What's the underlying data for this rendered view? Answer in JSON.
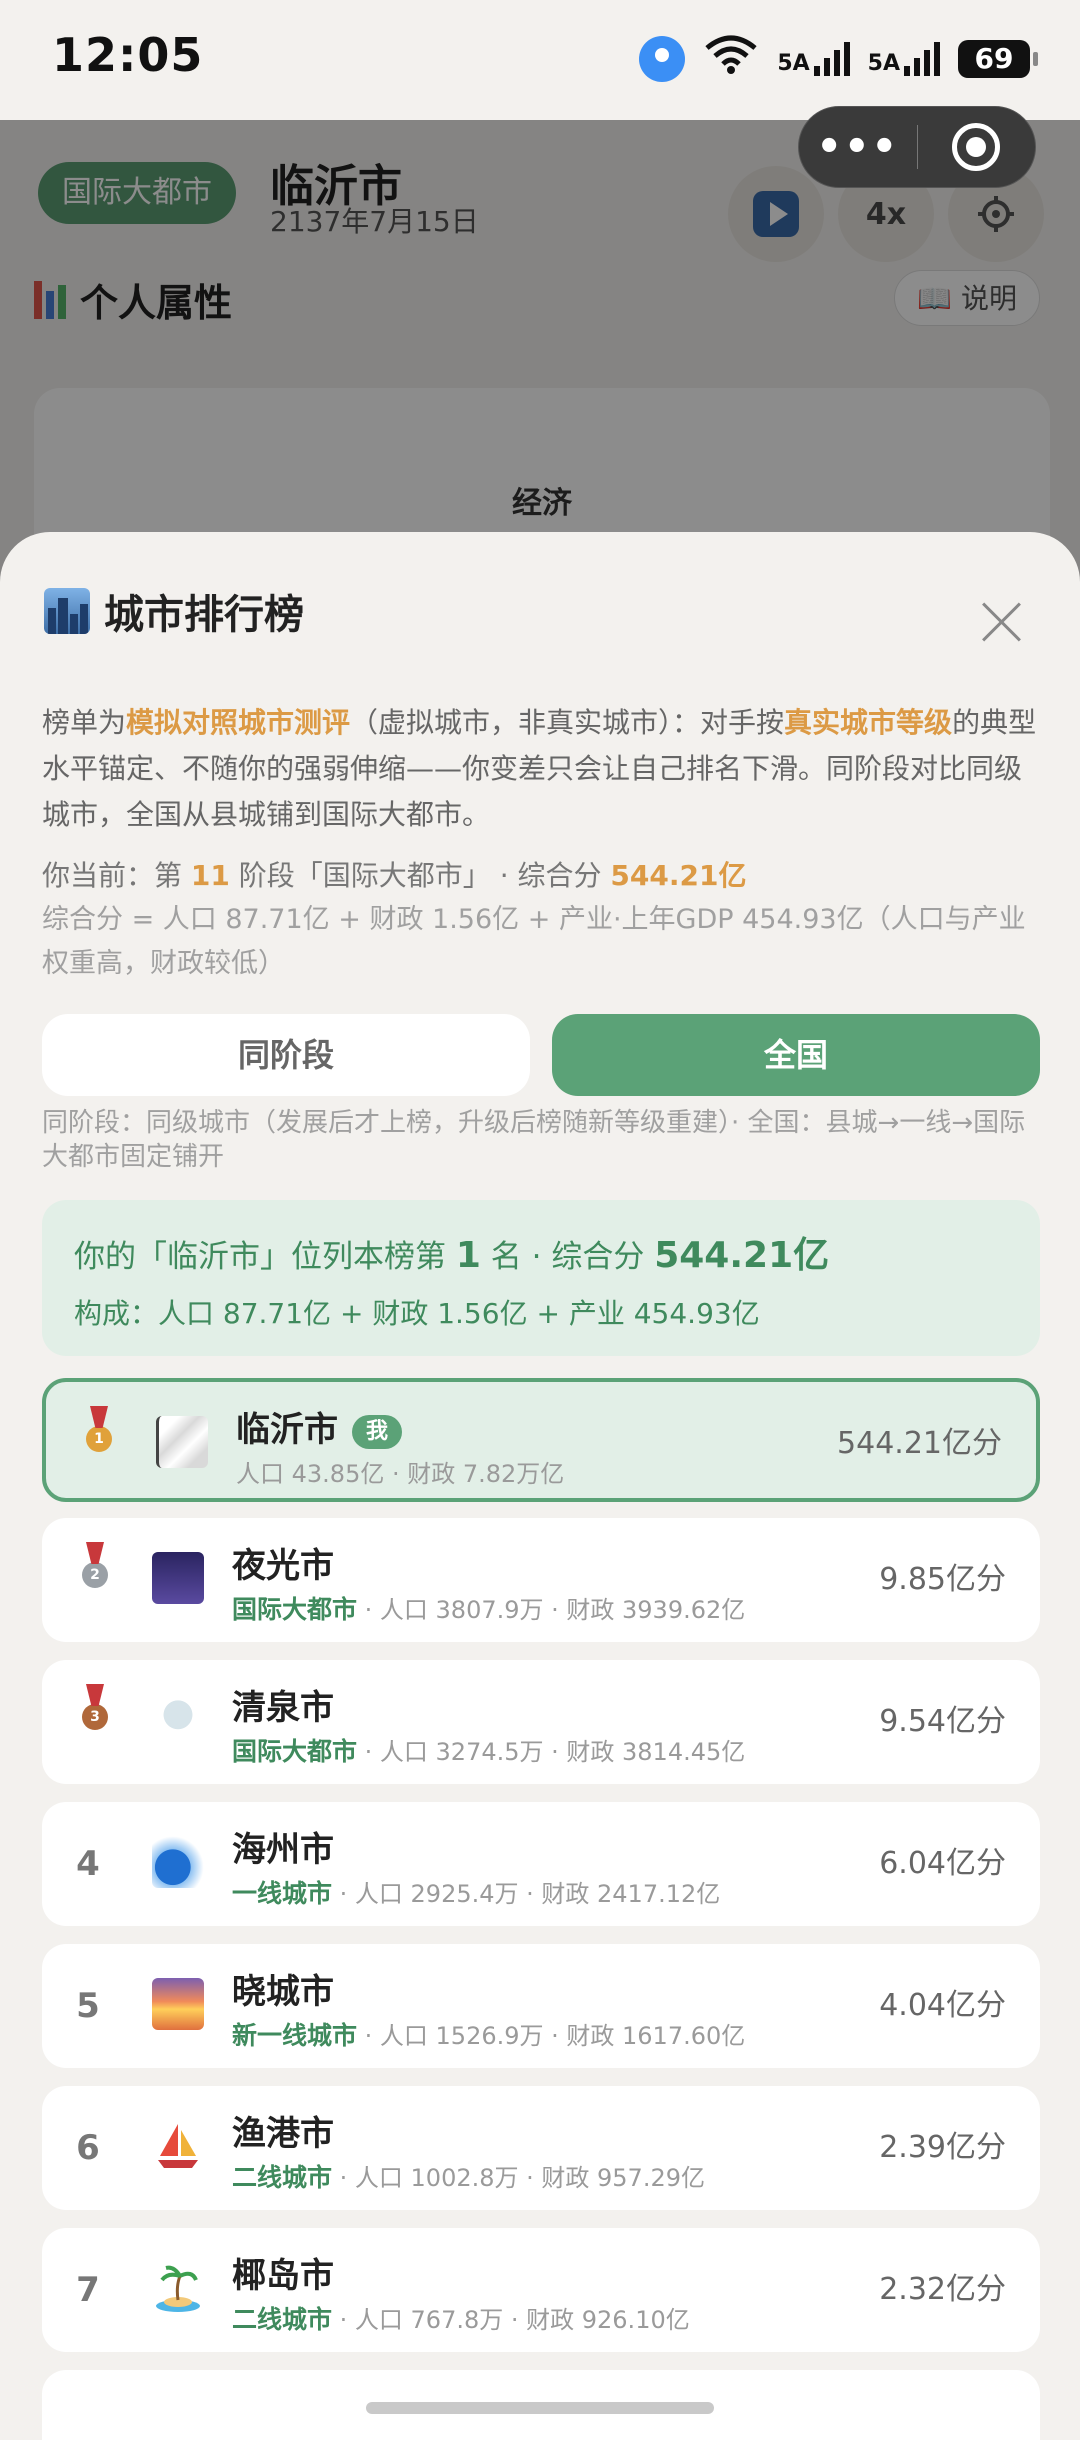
{
  "status_bar": {
    "time": "12:05",
    "signal1": "5A",
    "signal2": "5A",
    "battery": "69"
  },
  "background": {
    "tier_pill": "国际大都市",
    "city_name": "临沂市",
    "date": "2137年7月15日",
    "speed": "4x",
    "section_title": "个人属性",
    "help_label": "📖 说明",
    "card_label": "经济"
  },
  "sheet": {
    "title": "城市排行榜",
    "desc": {
      "p1": "榜单为",
      "h1": "模拟对照城市测评",
      "p2": "（虚拟城市，非真实城市）：对手按",
      "h2": "真实城市等级",
      "p3": "的典型水平锚定、不随你的强弱伸缩——你变差只会让自己排名下滑。同阶段对比同级城市，全国从县城铺到国际大都市。"
    },
    "current": {
      "prefix": "你当前：第",
      "stage": "11",
      "mid": "阶段「国际大都市」 · 综合分",
      "score": "544.21亿"
    },
    "formula": "综合分 = 人口 87.71亿 + 财政 1.56亿 + 产业·上年GDP 454.93亿（人口与产业权重高，财政较低）",
    "tabs": {
      "same_stage": "同阶段",
      "national": "全国"
    },
    "tab_note": "同阶段：同级城市（发展后才上榜，升级后榜随新等级重建）· 全国：县城→一线→国际大都市固定铺开",
    "summary": {
      "l1_prefix": "你的「临沂市」位列本榜第",
      "rank": "1",
      "l1_mid": "名 · 综合分",
      "score": "544.21亿",
      "l2": "构成：人口 87.71亿 + 财政 1.56亿 + 产业 454.93亿"
    },
    "me_badge": "我",
    "rankings": [
      {
        "rank": "1",
        "name": "临沂市",
        "tier": "",
        "meta": "人口 43.85亿 · 财政 7.82万亿",
        "score": "544.21亿分",
        "me": true
      },
      {
        "rank": "2",
        "name": "夜光市",
        "tier": "国际大都市",
        "meta": " · 人口 3807.9万 · 财政 3939.62亿",
        "score": "9.85亿分"
      },
      {
        "rank": "3",
        "name": "清泉市",
        "tier": "国际大都市",
        "meta": " · 人口 3274.5万 · 财政 3814.45亿",
        "score": "9.54亿分"
      },
      {
        "rank": "4",
        "name": "海州市",
        "tier": "一线城市",
        "meta": " · 人口 2925.4万 · 财政 2417.12亿",
        "score": "6.04亿分"
      },
      {
        "rank": "5",
        "name": "晓城市",
        "tier": "新一线城市",
        "meta": " · 人口 1526.9万 · 财政 1617.60亿",
        "score": "4.04亿分"
      },
      {
        "rank": "6",
        "name": "渔港市",
        "tier": "二线城市",
        "meta": " · 人口 1002.8万 · 财政 957.29亿",
        "score": "2.39亿分"
      },
      {
        "rank": "7",
        "name": "椰岛市",
        "tier": "二线城市",
        "meta": " · 人口 767.8万 · 财政 926.10亿",
        "score": "2.32亿分"
      }
    ]
  },
  "colors": {
    "accent_green": "#5ba277",
    "highlight_orange": "#dc9a45",
    "gold": "#e0a13a",
    "silver": "#9aa0a6",
    "bronze": "#b0683a"
  }
}
